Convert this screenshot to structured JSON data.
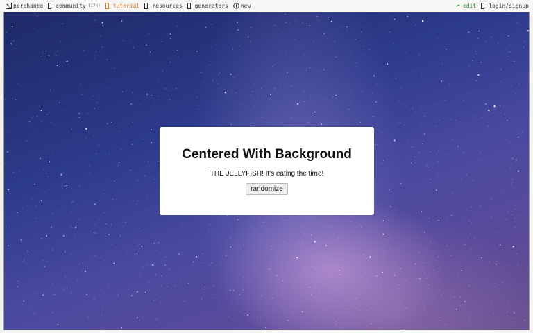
{
  "nav": {
    "home_label": "perchance",
    "community_label": "community",
    "community_badge": "(17h)",
    "tutorial_label": "tutorial",
    "resources_label": "resources",
    "generators_label": "generators",
    "new_label": "new",
    "edit_label": "edit",
    "login_label": "login/signup"
  },
  "card": {
    "title": "Centered With Background",
    "message": "THE JELLYFISH! It's eating the time!",
    "button_label": "randomize"
  },
  "colors": {
    "accent_tutorial": "#d77a1c",
    "accent_edit": "#2e8b2e",
    "sky_dark": "#1e2a68",
    "sky_light": "#6a5090"
  }
}
